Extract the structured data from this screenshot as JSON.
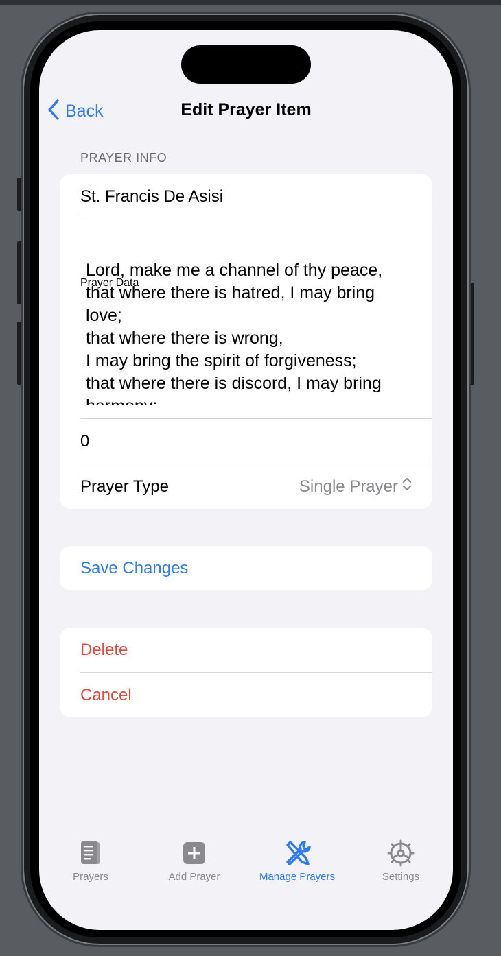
{
  "nav": {
    "back_label": "Back",
    "title": "Edit Prayer Item"
  },
  "form": {
    "section_header": "PRAYER INFO",
    "name_value": "St. Francis De Asisi",
    "prayer_data_label": "Prayer Data",
    "prayer_data_text": "Lord, make me a channel of thy peace,\nthat where there is hatred, I may bring love;\nthat where there is wrong,\nI may bring the spirit of forgiveness;\nthat where there is discord, I may bring harmony;",
    "count_value": "0",
    "prayer_type_label": "Prayer Type",
    "prayer_type_value": "Single Prayer"
  },
  "actions": {
    "save_label": "Save Changes",
    "delete_label": "Delete",
    "cancel_label": "Cancel"
  },
  "tabbar": {
    "items": [
      {
        "label": "Prayers",
        "icon": "document-icon"
      },
      {
        "label": "Add Prayer",
        "icon": "plus-square-icon"
      },
      {
        "label": "Manage Prayers",
        "icon": "wrench-screwdriver-icon"
      },
      {
        "label": "Settings",
        "icon": "gear-icon"
      }
    ],
    "active_index": 2
  },
  "colors": {
    "accent": "#2f7cf6",
    "destructive": "#e0493b",
    "background": "#f2f2f7"
  }
}
